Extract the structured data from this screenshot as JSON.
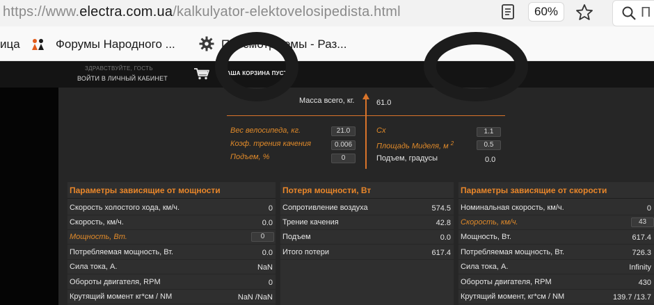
{
  "browser": {
    "url_prefix": "https://www.",
    "url_domain": "electra.com.ua",
    "url_path": "/kalkulyator-elektovelosipedista.html",
    "zoom": "60%",
    "search_placeholder_fragment": "П",
    "bookmarks": [
      {
        "label": "ица"
      },
      {
        "label": "Форумы Народного ..."
      },
      {
        "label": "Просмотр темы - Раз..."
      }
    ]
  },
  "site": {
    "greeting": "ЗДРАВСТВУЙТЕ, ГОСТЬ",
    "login": "ВОЙТИ В ЛИЧНЫЙ КАБИНЕТ",
    "cart": "ВАША КОРЗИНА ПУСТА"
  },
  "inputs": {
    "mass_total_label": "Масса всего, кг.",
    "mass_total_value": "61.0",
    "bike_weight_label": "Вес велосипеда, кг.",
    "bike_weight_value": "21.0",
    "rolling_coef_label": "Коэф. трения качения",
    "rolling_coef_value": "0.006",
    "slope_label": "Подъем, %",
    "slope_value": "0",
    "cx_label": "Cx",
    "cx_value": "1.1",
    "area_label": "Площадь Миделя, м",
    "area_sup": "2",
    "area_value": "0.5",
    "slope_deg_label": "Подъем, градусы",
    "slope_deg_value": "0.0"
  },
  "panels": {
    "power": {
      "title": "Параметры зависящие от мощности",
      "rows": [
        {
          "label": "Скорость холостого хода, км/ч.",
          "value": "0"
        },
        {
          "label": "Скорость, км/ч.",
          "value": "0.0"
        },
        {
          "label": "Мощность, Вт.",
          "value": "0"
        },
        {
          "label": "Потребляемая мощность, Вт.",
          "value": "0.0"
        },
        {
          "label": "Сила тока, А.",
          "value": "NaN"
        },
        {
          "label": "Обороты двигателя, RPM",
          "value": "0"
        },
        {
          "label": "Крутящий момент кг*см / NM",
          "value": "NaN /NaN"
        }
      ]
    },
    "loss": {
      "title": "Потеря мощности, Вт",
      "rows": [
        {
          "label": "Сопротивление воздуха",
          "value": "574.5"
        },
        {
          "label": "Трение качения",
          "value": "42.8"
        },
        {
          "label": "Подъем",
          "value": "0.0"
        },
        {
          "label": "Итого потери",
          "value": "617.4"
        }
      ]
    },
    "speed": {
      "title": "Параметры зависящие от скорости",
      "rows": [
        {
          "label": "Номинальная скорость, км/ч.",
          "value": "0"
        },
        {
          "label": "Скорость, км/ч.",
          "value": "43"
        },
        {
          "label": "Мощность, Вт.",
          "value": "617.4"
        },
        {
          "label": "Потребляемая мощность, Вт.",
          "value": "726.3"
        },
        {
          "label": "Сила тока, А.",
          "value": "Infinity"
        },
        {
          "label": "Обороты двигателя, RPM",
          "value": "430"
        },
        {
          "label": "Крутящий момент, кг*см / NM",
          "value": "139.7 /13.7"
        }
      ]
    }
  },
  "colors": {
    "accent_orange": "#e08a2a",
    "chrome_bg": "#f2f2f2",
    "page_bg": "#262626",
    "header_bg": "#141414"
  },
  "icons": {
    "reader": "reader-view-icon",
    "star": "bookmark-star-icon",
    "search": "search-icon",
    "cart": "cart-icon",
    "forum": "forum-favicon",
    "gear": "gear-icon"
  }
}
